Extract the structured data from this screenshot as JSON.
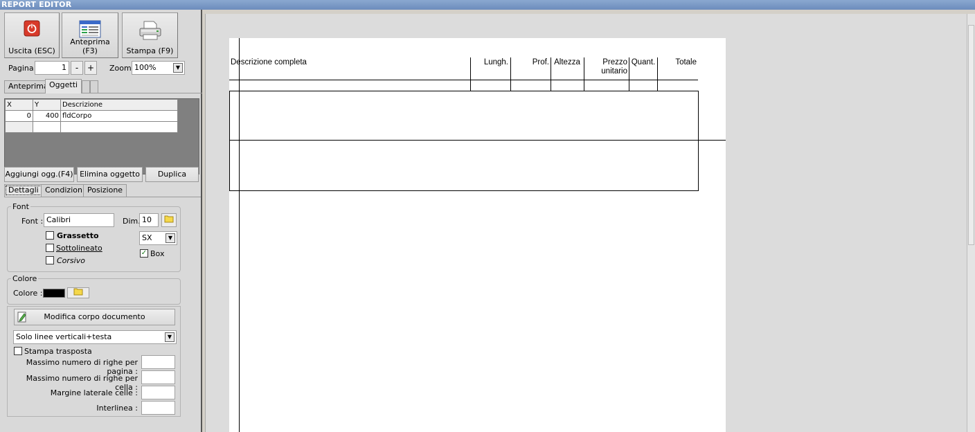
{
  "window": {
    "title": "REPORT EDITOR"
  },
  "toolbar": {
    "exit_label": "Uscita (ESC)",
    "preview_label": "Anteprima (F3)",
    "print_label": "Stampa (F9)"
  },
  "pager": {
    "page_label": "Pagina",
    "page_value": "1",
    "minus": "-",
    "plus": "+",
    "zoom_label": "Zoom",
    "zoom_value": "100%"
  },
  "top_tabs": {
    "preview": "Anteprima",
    "objects": "Oggetti"
  },
  "objects_grid": {
    "headers": [
      "X",
      "Y",
      "Descrizione"
    ],
    "rows": [
      {
        "x": "0",
        "y": "400",
        "desc": "fldCorpo"
      }
    ]
  },
  "object_actions": {
    "add": "Aggiungi ogg.(F4)",
    "delete": "Elimina oggetto",
    "duplicate": "Duplica"
  },
  "detail_tabs": {
    "details": "Dettagli",
    "conditions": "Condizioni",
    "position": "Posizione"
  },
  "font_group": {
    "legend": "Font",
    "font_label": "Font :",
    "font_value": "Calibri",
    "size_label": "Dim.",
    "size_value": "10",
    "bold_label": "Grassetto",
    "underline_label": "Sottolineato",
    "italic_label": "Corsivo",
    "align_value": "SX",
    "box_label": "Box",
    "bold_checked": false,
    "underline_checked": false,
    "italic_checked": false,
    "box_checked": true
  },
  "color_group": {
    "legend": "Colore",
    "color_label": "Colore :",
    "color_value": "#000000"
  },
  "body_group": {
    "edit_body_label": "Modifica corpo documento",
    "lines_mode": "Solo linee verticali+testa",
    "transposed_label": "Stampa trasposta",
    "transposed_checked": false,
    "max_rows_page_label": "Massimo numero di righe per pagina :",
    "max_rows_cell_label": "Massimo numero di righe per cella :",
    "cell_margin_label": "Margine laterale celle :",
    "line_spacing_label": "Interlinea :",
    "max_rows_page_value": "",
    "max_rows_cell_value": "",
    "cell_margin_value": "",
    "line_spacing_value": ""
  },
  "report_columns": {
    "desc": "Descrizione completa",
    "length": "Lungh.",
    "depth": "Prof.",
    "height": "Altezza",
    "price_line1": "Prezzo",
    "price_line2": "unitario",
    "qty": "Quant.",
    "total": "Totale"
  }
}
